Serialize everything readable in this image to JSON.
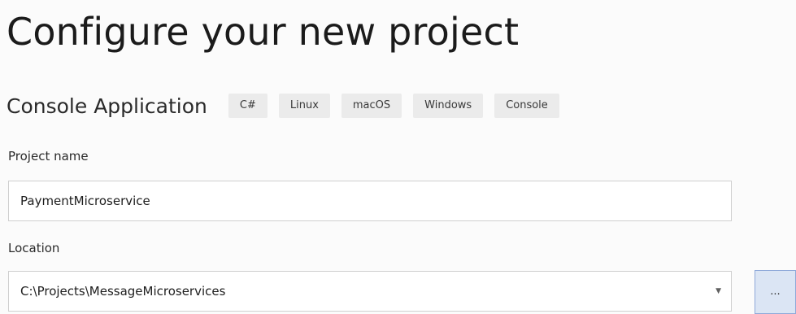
{
  "page": {
    "title": "Configure your new project"
  },
  "template": {
    "name": "Console Application",
    "tags": [
      "C#",
      "Linux",
      "macOS",
      "Windows",
      "Console"
    ]
  },
  "project_name": {
    "label": "Project name",
    "value": "PaymentMicroservice"
  },
  "location": {
    "label": "Location",
    "value": "C:\\Projects\\MessageMicroservices",
    "dropdown_icon": "chevron-down-icon",
    "browse_label": "..."
  }
}
